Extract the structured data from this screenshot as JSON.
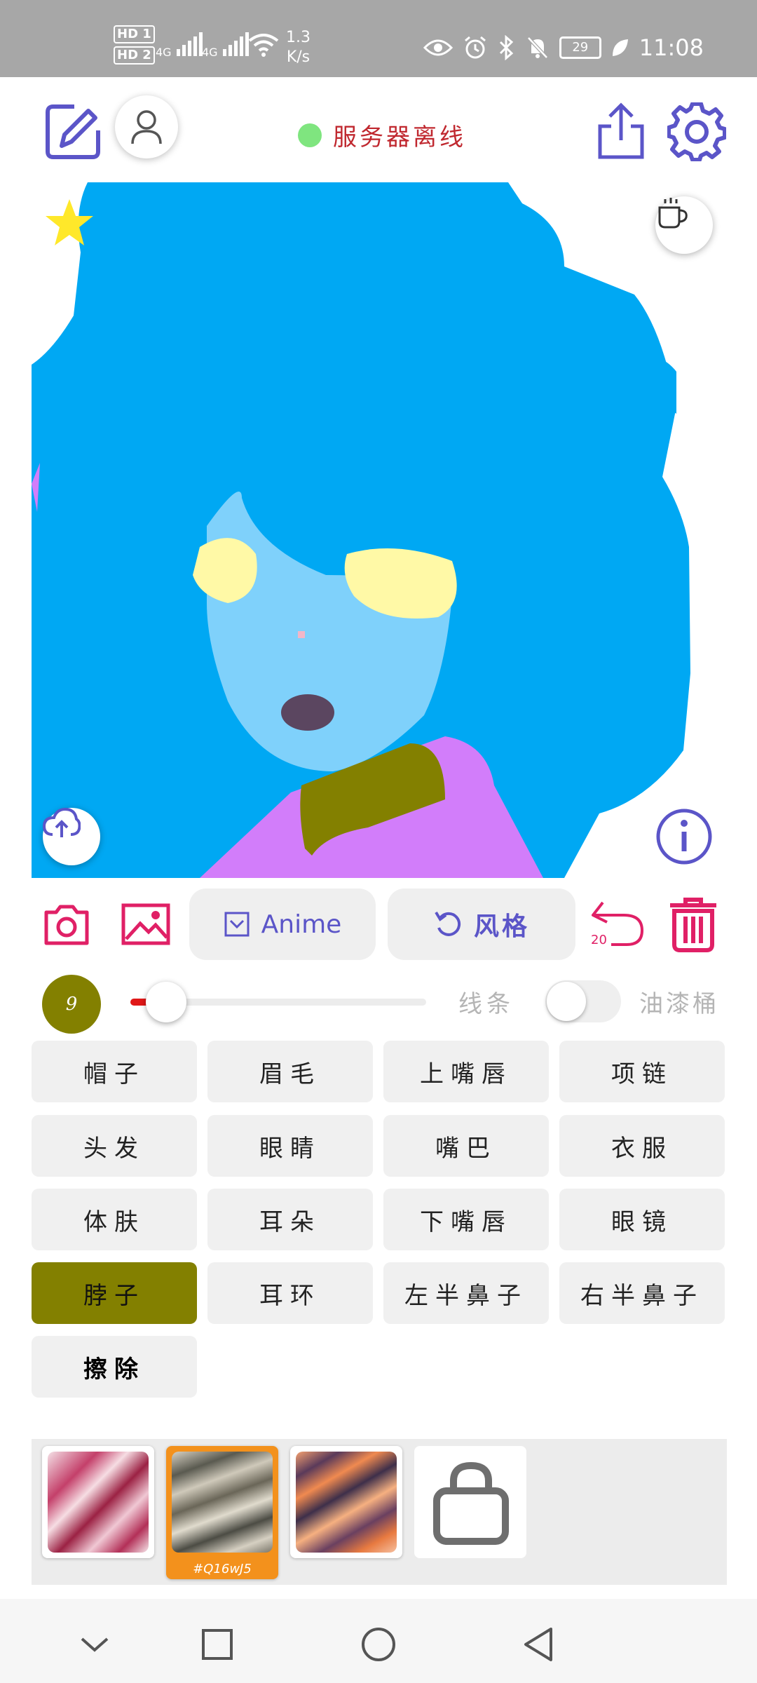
{
  "status_bar": {
    "hd1": "HD 1",
    "hd2": "HD 2",
    "net1": "4G",
    "net2": "4G",
    "speed_value": "1.3",
    "speed_unit": "K/s",
    "battery": "29",
    "time": "11:08"
  },
  "toolbar": {
    "server_status": "服务器离线",
    "server_status_color": "#7fe57f"
  },
  "actions": {
    "mode_label": "Anime",
    "style_label": "风格",
    "undo_count": "20"
  },
  "brush": {
    "size": "9",
    "color": "#838000",
    "line_label": "线条",
    "bucket_label": "油漆桶",
    "bucket_enabled": false
  },
  "parts": [
    {
      "label": "帽子"
    },
    {
      "label": "眉毛"
    },
    {
      "label": "上嘴唇"
    },
    {
      "label": "项链"
    },
    {
      "label": "头发"
    },
    {
      "label": "眼睛"
    },
    {
      "label": "嘴巴"
    },
    {
      "label": "衣服"
    },
    {
      "label": "体肤"
    },
    {
      "label": "耳朵"
    },
    {
      "label": "下嘴唇"
    },
    {
      "label": "眼镜"
    },
    {
      "label": "脖子",
      "active": true
    },
    {
      "label": "耳环"
    },
    {
      "label": "左半鼻子"
    },
    {
      "label": "右半鼻子"
    },
    {
      "label": "擦除"
    }
  ],
  "styles": {
    "selected_code": "#Q16wJ5"
  },
  "colors": {
    "accent_purple": "#5b55c8",
    "accent_pink": "#e02066",
    "hair": "#00a8f3",
    "skin": "#7fd1fb",
    "eyes": "#fff9a6",
    "clothes": "#d27dfa",
    "neck": "#838000",
    "mouth": "#5b4660"
  },
  "icons": {
    "edit": "edit-pencil-icon",
    "user": "user-icon",
    "share": "share-icon",
    "settings": "gear-icon",
    "star": "star-icon",
    "cup": "coffee-cup-icon",
    "upload": "cloud-upload-icon",
    "info": "info-icon",
    "camera": "camera-icon",
    "image": "image-icon",
    "undo": "undo-icon",
    "trash": "trash-icon",
    "lock": "lock-icon"
  }
}
